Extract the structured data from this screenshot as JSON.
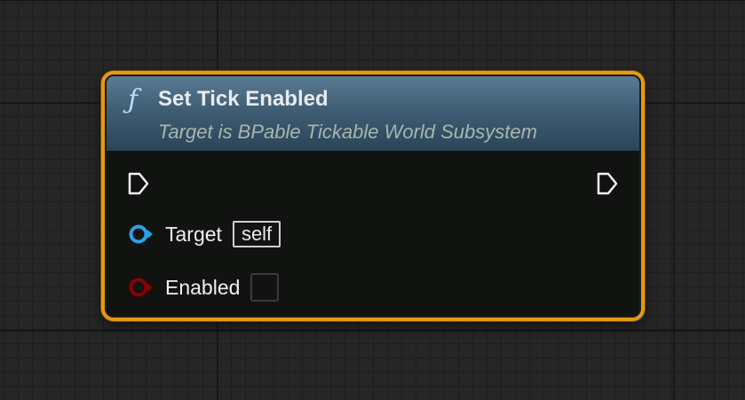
{
  "node": {
    "icon": "function-icon",
    "title": "Set Tick Enabled",
    "subtitle": "Target is BPable Tickable World Subsystem"
  },
  "pins": {
    "exec_in": "exec-input-pin-icon",
    "exec_out": "exec-output-pin-icon",
    "target": {
      "label": "Target",
      "value": "self",
      "icon": "object-reference-pin-icon",
      "color": "#2aa3e5"
    },
    "enabled": {
      "label": "Enabled",
      "icon": "boolean-pin-icon",
      "color": "#8b0000",
      "checked": false
    }
  },
  "colors": {
    "node_border": "#e69a12",
    "header_top": "#5a7b94",
    "header_bottom": "#2b4458",
    "background": "#262626"
  }
}
